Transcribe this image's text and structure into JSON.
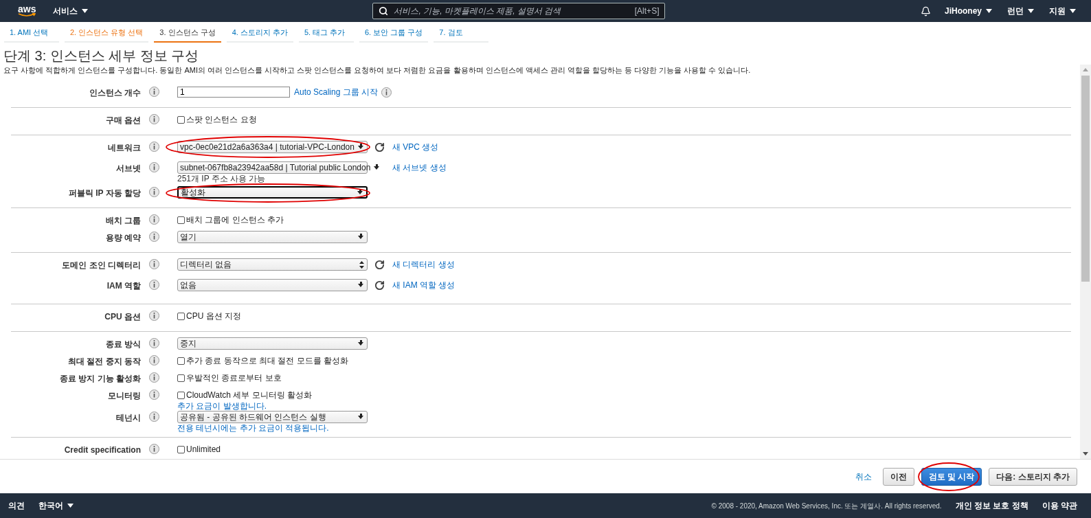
{
  "header": {
    "logo": "aws",
    "services": "서비스",
    "search": {
      "placeholder": "서비스, 기능, 마켓플레이스 제품, 설명서 검색",
      "shortcut": "[Alt+S]"
    },
    "menus": [
      "JiHooney",
      "런던",
      "지원"
    ]
  },
  "steps": [
    {
      "label": "1. AMI 선택",
      "selected": false,
      "visited": false
    },
    {
      "label": "2. 인스턴스 유형 선택",
      "selected": false,
      "visited": true
    },
    {
      "label": "3. 인스턴스 구성",
      "selected": true,
      "visited": false
    },
    {
      "label": "4. 스토리지 추가",
      "selected": false,
      "visited": false
    },
    {
      "label": "5. 태그 추가",
      "selected": false,
      "visited": false
    },
    {
      "label": "6. 보안 그룹 구성",
      "selected": false,
      "visited": false
    },
    {
      "label": "7. 검토",
      "selected": false,
      "visited": false
    }
  ],
  "title": "단계 3: 인스턴스 세부 정보 구성",
  "description": "요구 사항에 적합하게 인스턴스를 구성합니다. 동일한 AMI의 여러 인스턴스를 시작하고 스팟 인스턴스를 요청하여 보다 저렴한 요금을 활용하며 인스턴스에 액세스 관리 역할을 할당하는 등 다양한 기능을 사용할 수 있습니다.",
  "sections": [
    {
      "rows": [
        {
          "label": "인스턴스 개수",
          "kind": "input",
          "value": "1",
          "link": "Auto Scaling 그룹 시작",
          "link_help": true,
          "circled": false
        }
      ]
    },
    {
      "rows": [
        {
          "label": "구매 옵션",
          "kind": "checkbox",
          "text": "스팟 인스턴스 요청",
          "checked": false,
          "circled": false
        }
      ]
    },
    {
      "rows": [
        {
          "label": "네트워크",
          "kind": "select",
          "value": "vpc-0ec0e21d2a6a363a4 | tutorial-VPC-London",
          "spinner": false,
          "focused": false,
          "refresh": true,
          "link": "새 VPC 생성",
          "circled": true
        },
        {
          "label": "서브넷",
          "kind": "select",
          "value": "subnet-067fb8a23942aa58d | Tutorial public London",
          "spinner": false,
          "focused": false,
          "refresh": false,
          "link": "새 서브넷 생성",
          "note": {
            "text": "251개 IP 주소 사용 가능",
            "kind": "text"
          },
          "circled": false
        },
        {
          "label": "퍼블릭 IP 자동 할당",
          "kind": "select",
          "value": "활성화",
          "spinner": false,
          "focused": true,
          "circled": true
        }
      ]
    },
    {
      "rows": [
        {
          "label": "배치 그룹",
          "kind": "checkbox",
          "text": "배치 그룹에 인스턴스 추가",
          "checked": false,
          "circled": false
        },
        {
          "label": "용량 예약",
          "kind": "select",
          "value": "열기",
          "spinner": false,
          "focused": false,
          "circled": false
        }
      ]
    },
    {
      "rows": [
        {
          "label": "도메인 조인 디렉터리",
          "kind": "select",
          "value": "디렉터리 없음",
          "spinner": true,
          "focused": false,
          "refresh": true,
          "link": "새 디렉터리 생성",
          "circled": false
        },
        {
          "label": "IAM 역할",
          "kind": "select",
          "value": "없음",
          "spinner": false,
          "focused": false,
          "refresh": true,
          "link": "새 IAM 역할 생성",
          "circled": false
        }
      ]
    },
    {
      "rows": [
        {
          "label": "CPU 옵션",
          "kind": "checkbox",
          "text": "CPU 옵션 지정",
          "checked": false,
          "circled": false
        }
      ]
    },
    {
      "rows": [
        {
          "label": "종료 방식",
          "kind": "select",
          "value": "중지",
          "spinner": false,
          "focused": false,
          "circled": false
        },
        {
          "label": "최대 절전 중지 동작",
          "kind": "checkbox",
          "text": "추가 종료 동작으로 최대 절전 모드를 활성화",
          "checked": false,
          "circled": false
        },
        {
          "label": "종료 방지 기능 활성화",
          "kind": "checkbox",
          "text": "우발적인 종료로부터 보호",
          "checked": false,
          "circled": false
        },
        {
          "label": "모니터링",
          "kind": "checkbox",
          "text": "CloudWatch 세부 모니터링 활성화",
          "checked": false,
          "note": {
            "text": "추가 요금이 발생합니다.",
            "kind": "link"
          },
          "circled": false
        },
        {
          "label": "테넌시",
          "kind": "select",
          "value": "공유됨 - 공유된 하드웨어 인스턴스 실행",
          "spinner": false,
          "focused": false,
          "note": {
            "text": "전용 테넌시에는 추가 요금이 적용됩니다.",
            "kind": "link"
          },
          "circled": false
        }
      ]
    },
    {
      "rows": [
        {
          "label": "Credit specification",
          "kind": "checkbox",
          "text": "Unlimited",
          "checked": false,
          "circled": false
        }
      ]
    }
  ],
  "actions": {
    "cancel": "취소",
    "previous": "이전",
    "review": {
      "label": "검토 및 시작",
      "circled": true
    },
    "next": "다음: 스토리지 추가"
  },
  "footer": {
    "feedback": "의견",
    "language": "한국어",
    "copyright": "© 2008 - 2020, Amazon Web Services, Inc. 또는 계열사. All rights reserved.",
    "links": [
      "개인 정보 보호 정책",
      "이용 약관"
    ]
  }
}
